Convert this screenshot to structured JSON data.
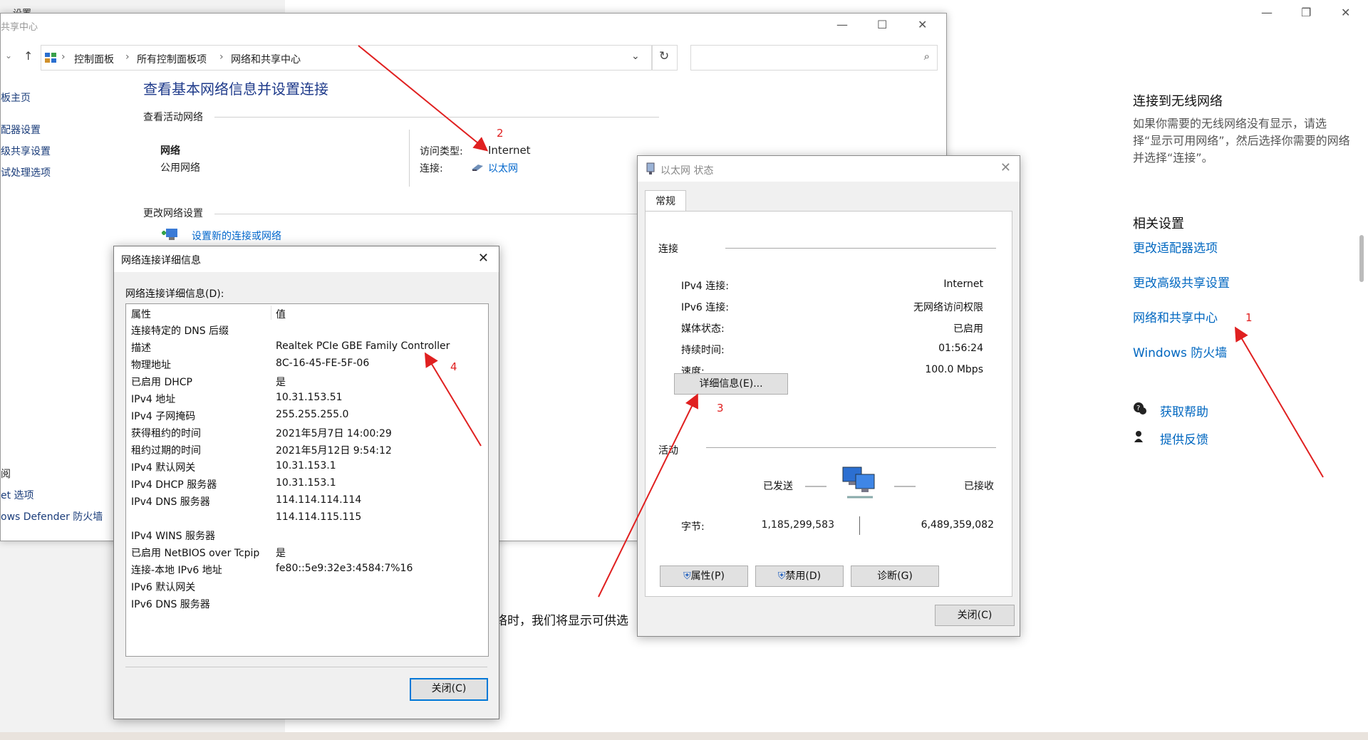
{
  "settings": {
    "title_partial": "设置",
    "win_controls": {
      "min": "—",
      "max": "❐",
      "close": "✕"
    },
    "wireless_heading": "连接到无线网络",
    "wireless_desc": "如果你需要的无线网络没有显示，请选择“显示可用网络”，然后选择你需要的网络并选择“连接”。",
    "related_heading": "相关设置",
    "related_links": [
      "更改适配器选项",
      "更改高级共享设置",
      "网络和共享中心",
      "Windows 防火墙"
    ],
    "help_links": [
      "获取帮助",
      "提供反馈"
    ],
    "bg_text_fragment": "络时，我们将显示可供选"
  },
  "control_panel": {
    "title_partial": "共享中心",
    "breadcrumbs": [
      "控制面板",
      "所有控制面板项",
      "网络和共享中心"
    ],
    "sidebar": [
      "板主页",
      "配器设置",
      "级共享设置",
      "试处理选项",
      "阅",
      "et 选项",
      "ows Defender 防火墙"
    ],
    "heading": "查看基本网络信息并设置连接",
    "active_networks_label": "查看活动网络",
    "network_name": "网络",
    "network_type": "公用网络",
    "access_type_label": "访问类型:",
    "access_type_value": "Internet",
    "connection_label": "连接:",
    "connection_value": "以太网",
    "change_settings_label": "更改网络设置",
    "setup_link": "设置新的连接或网络"
  },
  "details_dialog": {
    "title": "网络连接详细信息",
    "list_label": "网络连接详细信息(D):",
    "col_property": "属性",
    "col_value": "值",
    "rows": [
      {
        "k": "连接特定的 DNS 后缀",
        "v": ""
      },
      {
        "k": "描述",
        "v": "Realtek PCIe GBE Family Controller"
      },
      {
        "k": "物理地址",
        "v": "8C-16-45-FE-5F-06"
      },
      {
        "k": "已启用 DHCP",
        "v": "是"
      },
      {
        "k": "IPv4 地址",
        "v": "10.31.153.51"
      },
      {
        "k": "IPv4 子网掩码",
        "v": "255.255.255.0"
      },
      {
        "k": "获得租约的时间",
        "v": "2021年5月7日 14:00:29"
      },
      {
        "k": "租约过期的时间",
        "v": "2021年5月12日 9:54:12"
      },
      {
        "k": "IPv4 默认网关",
        "v": "10.31.153.1"
      },
      {
        "k": "IPv4 DHCP 服务器",
        "v": "10.31.153.1"
      },
      {
        "k": "IPv4 DNS 服务器",
        "v": "114.114.114.114"
      },
      {
        "k": "",
        "v": "114.114.115.115"
      },
      {
        "k": "IPv4 WINS 服务器",
        "v": ""
      },
      {
        "k": "已启用 NetBIOS over Tcpip",
        "v": "是"
      },
      {
        "k": "连接-本地 IPv6 地址",
        "v": "fe80::5e9:32e3:4584:7%16"
      },
      {
        "k": "IPv6 默认网关",
        "v": ""
      },
      {
        "k": "IPv6 DNS 服务器",
        "v": ""
      }
    ],
    "close_button": "关闭(C)"
  },
  "ethernet_dialog": {
    "title": "以太网 状态",
    "tab": "常规",
    "connection_group": "连接",
    "rows": [
      {
        "k": "IPv4 连接:",
        "v": "Internet"
      },
      {
        "k": "IPv6 连接:",
        "v": "无网络访问权限"
      },
      {
        "k": "媒体状态:",
        "v": "已启用"
      },
      {
        "k": "持续时间:",
        "v": "01:56:24"
      },
      {
        "k": "速度:",
        "v": "100.0 Mbps"
      }
    ],
    "details_button": "详细信息(E)...",
    "activity_group": "活动",
    "sent_label": "已发送",
    "received_label": "已接收",
    "bytes_label": "字节:",
    "bytes_sent": "1,185,299,583",
    "bytes_received": "6,489,359,082",
    "properties_button": "属性(P)",
    "disable_button": "禁用(D)",
    "diagnose_button": "诊断(G)",
    "close_button": "关闭(C)"
  },
  "annotations": [
    "1",
    "2",
    "3",
    "4"
  ],
  "colors": {
    "link": "#0067c0",
    "arrow": "#e02020",
    "accent": "#0078d7"
  }
}
